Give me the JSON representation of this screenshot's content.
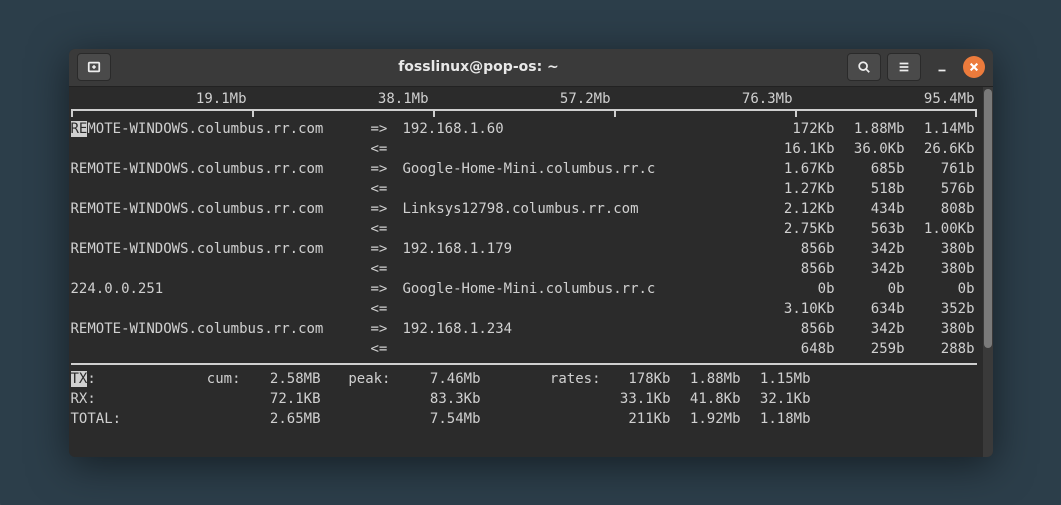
{
  "window": {
    "title": "fosslinux@pop-os: ~"
  },
  "scale": [
    "19.1Mb",
    "38.1Mb",
    "57.2Mb",
    "76.3Mb",
    "95.4Mb"
  ],
  "connections": [
    {
      "src": "REMOTE-WINDOWS.columbus.rr.com",
      "dst": "192.168.1.60",
      "tx": [
        "172Kb",
        "1.88Mb",
        "1.14Mb"
      ],
      "rx": [
        "16.1Kb",
        "36.0Kb",
        "26.6Kb"
      ]
    },
    {
      "src": "REMOTE-WINDOWS.columbus.rr.com",
      "dst": "Google-Home-Mini.columbus.rr.c",
      "tx": [
        "1.67Kb",
        "685b",
        "761b"
      ],
      "rx": [
        "1.27Kb",
        "518b",
        "576b"
      ]
    },
    {
      "src": "REMOTE-WINDOWS.columbus.rr.com",
      "dst": "Linksys12798.columbus.rr.com",
      "tx": [
        "2.12Kb",
        "434b",
        "808b"
      ],
      "rx": [
        "2.75Kb",
        "563b",
        "1.00Kb"
      ]
    },
    {
      "src": "REMOTE-WINDOWS.columbus.rr.com",
      "dst": "192.168.1.179",
      "tx": [
        "856b",
        "342b",
        "380b"
      ],
      "rx": [
        "856b",
        "342b",
        "380b"
      ]
    },
    {
      "src": "224.0.0.251",
      "dst": "Google-Home-Mini.columbus.rr.c",
      "tx": [
        "0b",
        "0b",
        "0b"
      ],
      "rx": [
        "3.10Kb",
        "634b",
        "352b"
      ]
    },
    {
      "src": "REMOTE-WINDOWS.columbus.rr.com",
      "dst": "192.168.1.234",
      "tx": [
        "856b",
        "342b",
        "380b"
      ],
      "rx": [
        "648b",
        "259b",
        "288b"
      ]
    }
  ],
  "summary": {
    "labels": {
      "tx": "TX:",
      "rx": "RX:",
      "total": "TOTAL:",
      "cum": "cum:",
      "peak": "peak:",
      "rates": "rates:"
    },
    "tx": {
      "cum": "2.58MB",
      "peak": "7.46Mb",
      "rates": [
        "178Kb",
        "1.88Mb",
        "1.15Mb"
      ]
    },
    "rx": {
      "cum": "72.1KB",
      "peak": "83.3Kb",
      "rates": [
        "33.1Kb",
        "41.8Kb",
        "32.1Kb"
      ]
    },
    "total": {
      "cum": "2.65MB",
      "peak": "7.54Mb",
      "rates": [
        "211Kb",
        "1.92Mb",
        "1.18Mb"
      ]
    }
  },
  "arrows": {
    "out": "=>",
    "in": "<="
  },
  "highlight": {
    "src_prefix": "RE",
    "src_rest": "MOTE-WINDOWS.columbus.rr.com",
    "sum_prefix": "TX",
    "sum_rest": ":"
  }
}
